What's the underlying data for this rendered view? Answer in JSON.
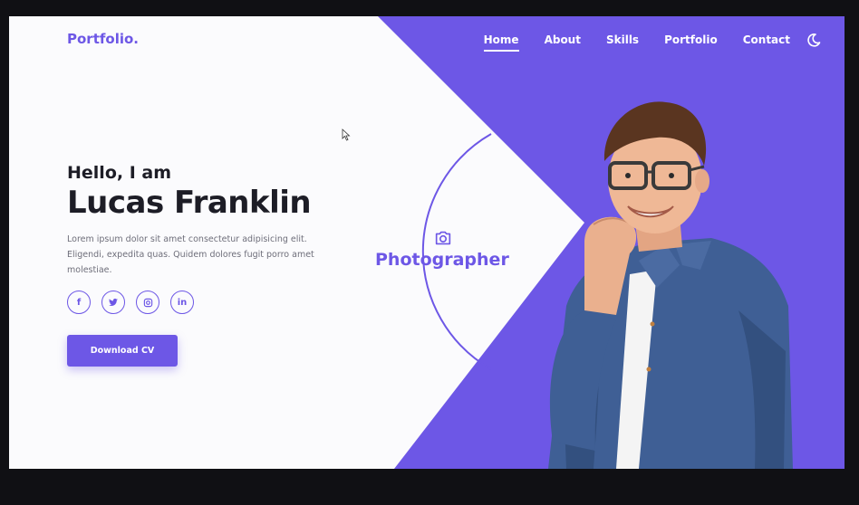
{
  "brand": {
    "logo": "Portfolio."
  },
  "nav": {
    "items": [
      {
        "label": "Home",
        "active": true
      },
      {
        "label": "About",
        "active": false
      },
      {
        "label": "Skills",
        "active": false
      },
      {
        "label": "Portfolio",
        "active": false
      },
      {
        "label": "Contact",
        "active": false
      }
    ],
    "theme_icon": "moon-icon"
  },
  "hero": {
    "greeting": "Hello, I am",
    "name": "Lucas Franklin",
    "description": "Lorem ipsum dolor sit amet consectetur adipisicing elit. Eligendi, expedita quas. Quidem dolores fugit porro amet molestiae.",
    "role": "Photographer",
    "role_icon": "camera-icon",
    "download_label": "Download CV"
  },
  "socials": [
    {
      "name": "facebook-icon",
      "glyph": "f"
    },
    {
      "name": "twitter-icon",
      "glyph": "t"
    },
    {
      "name": "instagram-icon",
      "glyph": "◎"
    },
    {
      "name": "linkedin-icon",
      "glyph": "in"
    }
  ],
  "colors": {
    "accent": "#6d57e6",
    "dark_text": "#1d1d26",
    "body_text": "#6e6e7a",
    "background": "#fbfbfd"
  }
}
